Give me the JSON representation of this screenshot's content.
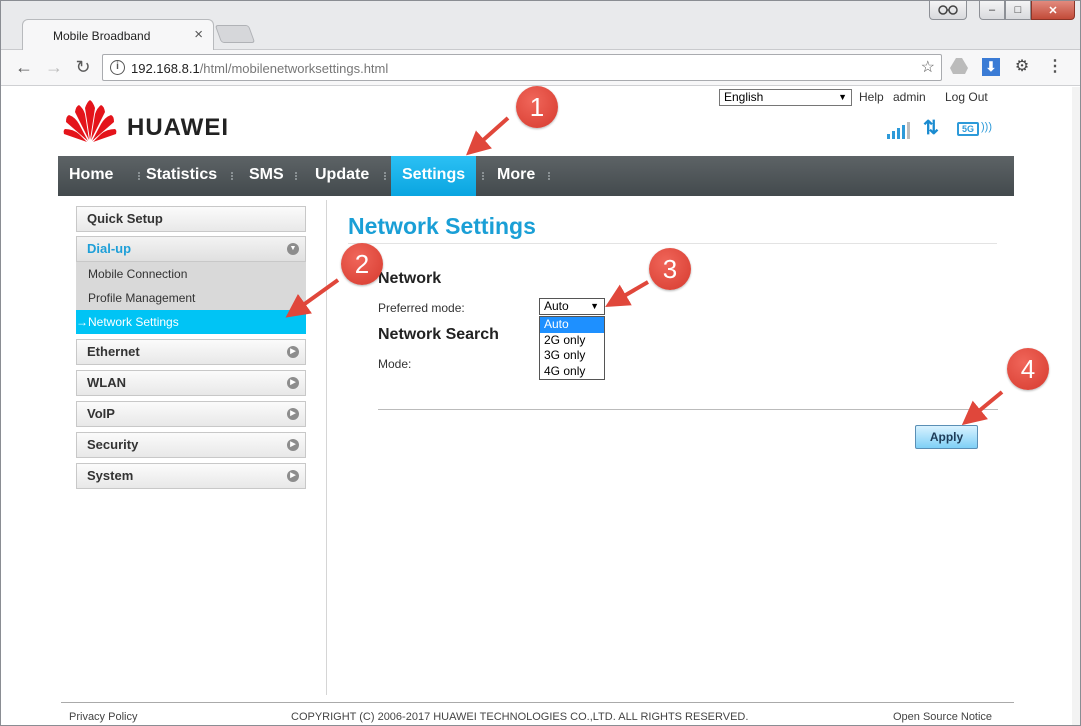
{
  "browser": {
    "tab_title": "Mobile Broadband",
    "tab_close": "×",
    "url_host": "192.168.8.1",
    "url_path": "/html/mobilenetworksettings.html",
    "back": "←",
    "forward": "→",
    "reload": "↻",
    "star": "☆",
    "menu": "⋮",
    "min": "–",
    "max": "□",
    "close": "✕"
  },
  "header": {
    "brand": "HUAWEI",
    "language": "English",
    "help": "Help",
    "user": "admin",
    "logout": "Log Out",
    "net_badge": "5G",
    "brand_color": "#e4141b"
  },
  "nav": {
    "items": [
      "Home",
      "Statistics",
      "SMS",
      "Update",
      "Settings",
      "More"
    ],
    "active": "Settings",
    "active_color": "#1aaee8"
  },
  "sidebar": {
    "quick_setup": "Quick Setup",
    "dialup": "Dial-up",
    "dialup_sub": [
      "Mobile Connection",
      "Profile Management",
      "Network Settings"
    ],
    "active_sub": "Network Settings",
    "ethernet": "Ethernet",
    "wlan": "WLAN",
    "voip": "VoIP",
    "security": "Security",
    "system": "System"
  },
  "content": {
    "title": "Network Settings",
    "network_heading": "Network",
    "preferred_mode_label": "Preferred mode:",
    "preferred_mode_value": "Auto",
    "mode_options": [
      "Auto",
      "2G only",
      "3G only",
      "4G only"
    ],
    "network_search_heading": "Network Search",
    "mode_label": "Mode:",
    "apply": "Apply"
  },
  "footer": {
    "privacy": "Privacy Policy",
    "copyright": "COPYRIGHT (C) 2006-2017 HUAWEI TECHNOLOGIES CO.,LTD. ALL RIGHTS RESERVED.",
    "open_source": "Open Source Notice"
  },
  "annotations": [
    "1",
    "2",
    "3",
    "4"
  ],
  "annotation_color": "#e0473b"
}
